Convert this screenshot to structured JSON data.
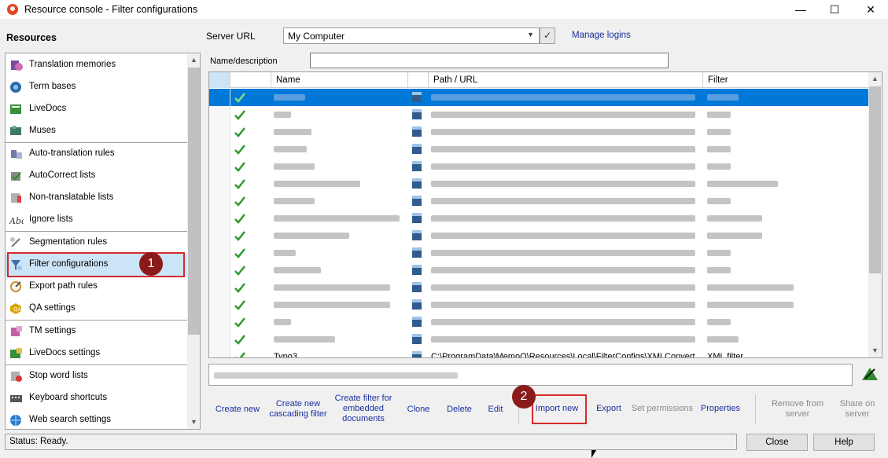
{
  "window": {
    "title": "Resource console - Filter configurations",
    "min_glyph": "—",
    "max_glyph": "☐",
    "close_glyph": "✕"
  },
  "sidebar": {
    "header": "Resources",
    "items": [
      {
        "label": "Translation memories",
        "icon": "translation-memories-icon"
      },
      {
        "label": "Term bases",
        "icon": "term-bases-icon"
      },
      {
        "label": "LiveDocs",
        "icon": "livedocs-icon"
      },
      {
        "label": "Muses",
        "icon": "muses-icon"
      },
      {
        "label": "Auto-translation rules",
        "icon": "auto-translation-icon"
      },
      {
        "label": "AutoCorrect lists",
        "icon": "autocorrect-icon"
      },
      {
        "label": "Non-translatable lists",
        "icon": "non-translatable-icon"
      },
      {
        "label": "Ignore lists",
        "icon": "ignore-lists-icon"
      },
      {
        "label": "Segmentation rules",
        "icon": "segmentation-icon"
      },
      {
        "label": "Filter configurations",
        "icon": "filter-config-icon"
      },
      {
        "label": "Export path rules",
        "icon": "export-path-icon"
      },
      {
        "label": "QA settings",
        "icon": "qa-settings-icon"
      },
      {
        "label": "TM settings",
        "icon": "tm-settings-icon"
      },
      {
        "label": "LiveDocs settings",
        "icon": "livedocs-settings-icon"
      },
      {
        "label": "Stop word lists",
        "icon": "stop-word-icon"
      },
      {
        "label": "Keyboard shortcuts",
        "icon": "keyboard-icon"
      },
      {
        "label": "Web search settings",
        "icon": "web-search-icon"
      }
    ],
    "selected_index": 9
  },
  "callouts": {
    "one": "1",
    "two": "2"
  },
  "server": {
    "label": "Server URL",
    "value": "My Computer",
    "ok_glyph": "✓",
    "manage_link": "Manage logins"
  },
  "filter_field": {
    "label": "Name/description",
    "value": ""
  },
  "table": {
    "headers": [
      "Name",
      "Path / URL",
      "Filter"
    ],
    "last_row": {
      "name": "Typo3",
      "path": "C:\\ProgramData\\MemoQ\\Resources\\Local\\FilterConfigs\\XMLConvert...",
      "filter": "XML filter"
    }
  },
  "toolbar": {
    "create_new": "Create new",
    "create_cascading": "Create new cascading filter",
    "create_embedded": "Create filter for embedded documents",
    "clone": "Clone",
    "delete": "Delete",
    "edit": "Edit",
    "import_new": "Import new",
    "export": "Export",
    "set_permissions": "Set permissions",
    "properties": "Properties",
    "remove_from_server": "Remove from server",
    "share_on_server": "Share on server"
  },
  "status": {
    "text": "Status: Ready."
  },
  "buttons": {
    "close": "Close",
    "help": "Help"
  },
  "colors": {
    "accent": "#0078d7",
    "link": "#1a2f9e",
    "callout": "#d62a2a",
    "callout_fill": "#8b1a1a"
  }
}
